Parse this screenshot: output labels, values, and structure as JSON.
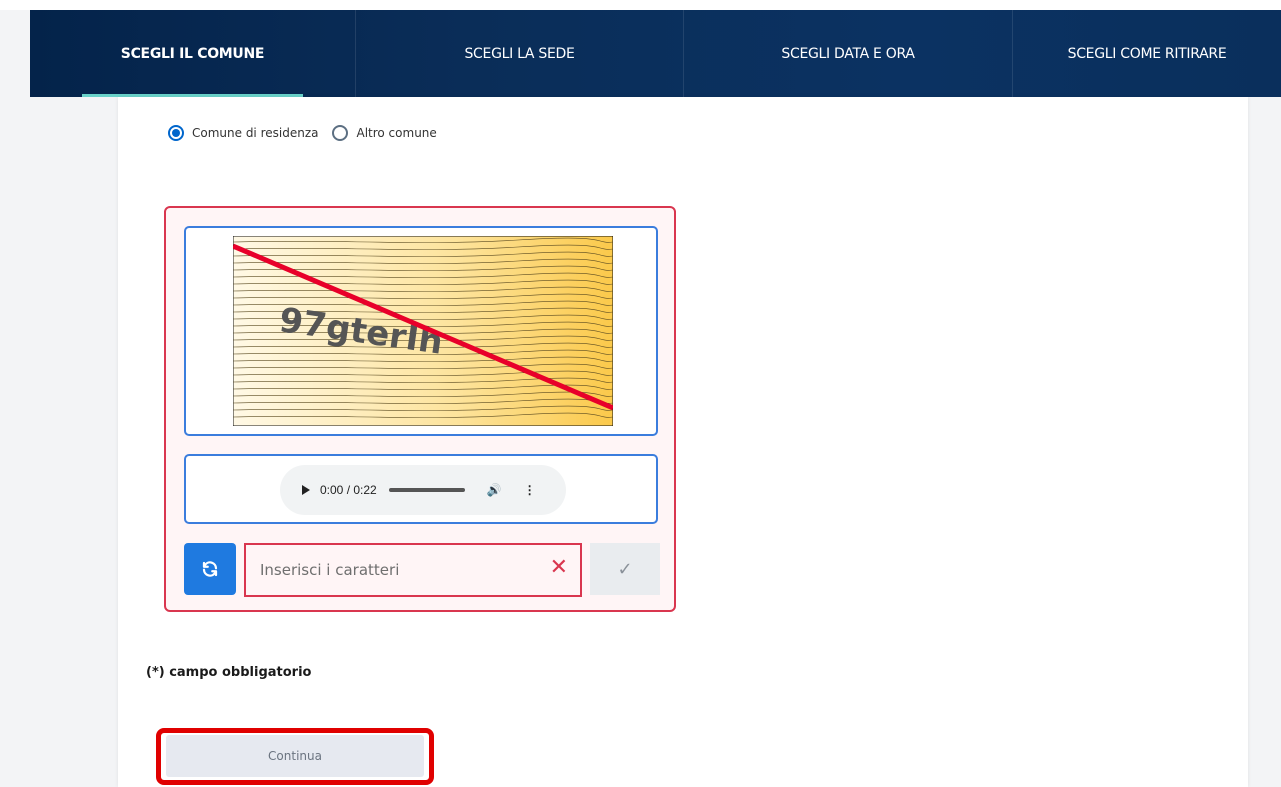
{
  "tabs": [
    {
      "label": "SCEGLI IL COMUNE",
      "active": true
    },
    {
      "label": "SCEGLI LA SEDE",
      "active": false
    },
    {
      "label": "SCEGLI DATA E ORA",
      "active": false
    },
    {
      "label": "SCEGLI COME RITIRARE",
      "active": false
    }
  ],
  "radio": {
    "option1": "Comune di residenza",
    "option2": "Altro comune",
    "selected": "Comune di residenza"
  },
  "captcha": {
    "image_text": "97gterIh",
    "audio": {
      "time": "0:00 / 0:22"
    },
    "input_placeholder": "Inserisci i caratteri",
    "input_value": "",
    "refresh_icon": "refresh-icon",
    "clear_icon": "close-icon",
    "confirm_icon": "check-icon"
  },
  "form": {
    "required_note": "(*) campo obbligatorio",
    "continue_label": "Continua"
  },
  "colors": {
    "nav_bg": "#0a2d58",
    "active_underline": "#69d2c9",
    "primary_blue": "#1f7ae0",
    "error_red": "#d9364f",
    "highlight_red": "#e00000"
  }
}
